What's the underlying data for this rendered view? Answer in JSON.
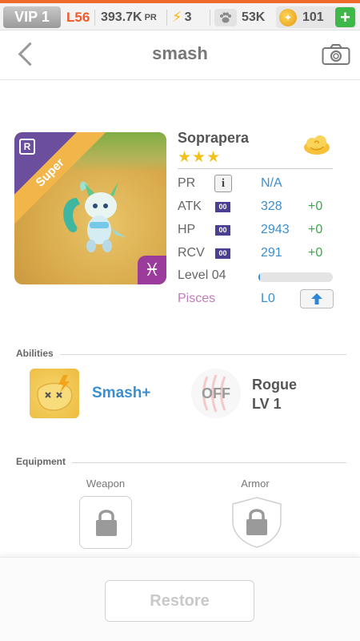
{
  "status_bar": {
    "vip": "VIP 1",
    "level": "L56",
    "power": "393.7K",
    "power_unit": "PR",
    "energy": "3",
    "food": "53K",
    "coins": "101",
    "add_label": "+"
  },
  "header": {
    "title": "smash"
  },
  "monster": {
    "name": "Soprapera",
    "rarity_label": "Super",
    "rank_badge": "R",
    "stars": "★★★",
    "zodiac_symbol": "♓",
    "stats": {
      "pr": {
        "label": "PR",
        "info": "i",
        "value": "N/A"
      },
      "atk": {
        "label": "ATK",
        "tag": "00",
        "value": "328",
        "bonus": "+0"
      },
      "hp": {
        "label": "HP",
        "tag": "00",
        "value": "2943",
        "bonus": "+0"
      },
      "rcv": {
        "label": "RCV",
        "tag": "00",
        "value": "291",
        "bonus": "+0"
      }
    },
    "level_label": "Level 04",
    "level_progress": 0.02,
    "sign_label": "Pisces",
    "sign_level": "L0"
  },
  "abilities": {
    "section_title": "Abilities",
    "primary": {
      "name": "Smash+",
      "icon": "smash-ability-icon"
    },
    "secondary": {
      "state": "OFF",
      "name": "Rogue",
      "level": "LV 1",
      "icon": "claw-ability-icon"
    }
  },
  "equipment": {
    "section_title": "Equipment",
    "weapon_label": "Weapon",
    "armor_label": "Armor"
  },
  "footer": {
    "restore_label": "Restore"
  },
  "colors": {
    "accent_orange": "#f26a2a",
    "stat_blue": "#3a8fd0",
    "bonus_green": "#3aa84a",
    "pisces_pink": "#c27bbd",
    "tag_purple": "#4a3f93"
  }
}
